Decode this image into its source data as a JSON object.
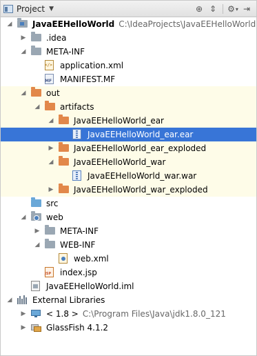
{
  "toolbar": {
    "title": "Project",
    "dropdown_icon": "chevron-down-icon",
    "buttons": [
      {
        "name": "target-icon",
        "glyph": "⊕"
      },
      {
        "name": "collapse-all-icon",
        "glyph": "↕"
      },
      {
        "name": "gear-icon",
        "glyph": "⚙"
      },
      {
        "name": "hide-icon",
        "glyph": "→"
      }
    ]
  },
  "tree": [
    {
      "label": "JavaEEHelloWorld",
      "path": "C:\\IdeaProjects\\JavaEEHelloWorld",
      "bold": true,
      "expanded": true,
      "icon": "module-folder-icon"
    },
    {
      "label": ".idea",
      "expanded": false,
      "icon": "folder-icon"
    },
    {
      "label": "META-INF",
      "expanded": true,
      "icon": "folder-icon"
    },
    {
      "label": "application.xml",
      "icon": "xml-file-icon"
    },
    {
      "label": "MANIFEST.MF",
      "icon": "manifest-file-icon"
    },
    {
      "label": "out",
      "expanded": true,
      "icon": "excluded-folder-icon",
      "highlight": true
    },
    {
      "label": "artifacts",
      "expanded": true,
      "icon": "excluded-folder-icon",
      "highlight": true
    },
    {
      "label": "JavaEEHelloWorld_ear",
      "expanded": true,
      "icon": "excluded-folder-icon",
      "highlight": true
    },
    {
      "label": "JavaEEHelloWorld_ear.ear",
      "icon": "archive-file-icon",
      "selected": true
    },
    {
      "label": "JavaEEHelloWorld_ear_exploded",
      "expanded": false,
      "icon": "excluded-folder-icon",
      "highlight": true
    },
    {
      "label": "JavaEEHelloWorld_war",
      "expanded": true,
      "icon": "excluded-folder-icon",
      "highlight": true
    },
    {
      "label": "JavaEEHelloWorld_war.war",
      "icon": "archive-file-icon",
      "highlight": true
    },
    {
      "label": "JavaEEHelloWorld_war_exploded",
      "expanded": false,
      "icon": "excluded-folder-icon",
      "highlight": true
    },
    {
      "label": "src",
      "icon": "source-folder-icon"
    },
    {
      "label": "web",
      "expanded": true,
      "icon": "web-folder-icon"
    },
    {
      "label": "META-INF",
      "expanded": false,
      "icon": "folder-icon"
    },
    {
      "label": "WEB-INF",
      "expanded": true,
      "icon": "folder-icon"
    },
    {
      "label": "web.xml",
      "icon": "web-xml-file-icon"
    },
    {
      "label": "index.jsp",
      "icon": "jsp-file-icon"
    },
    {
      "label": "JavaEEHelloWorld.iml",
      "icon": "iml-file-icon"
    },
    {
      "label": "External Libraries",
      "expanded": true,
      "icon": "libraries-icon"
    },
    {
      "label": "< 1.8 >",
      "path": "C:\\Program Files\\Java\\jdk1.8.0_121",
      "expanded": false,
      "icon": "jdk-icon"
    },
    {
      "label": "GlassFish 4.1.2",
      "expanded": false,
      "icon": "library-icon"
    }
  ]
}
